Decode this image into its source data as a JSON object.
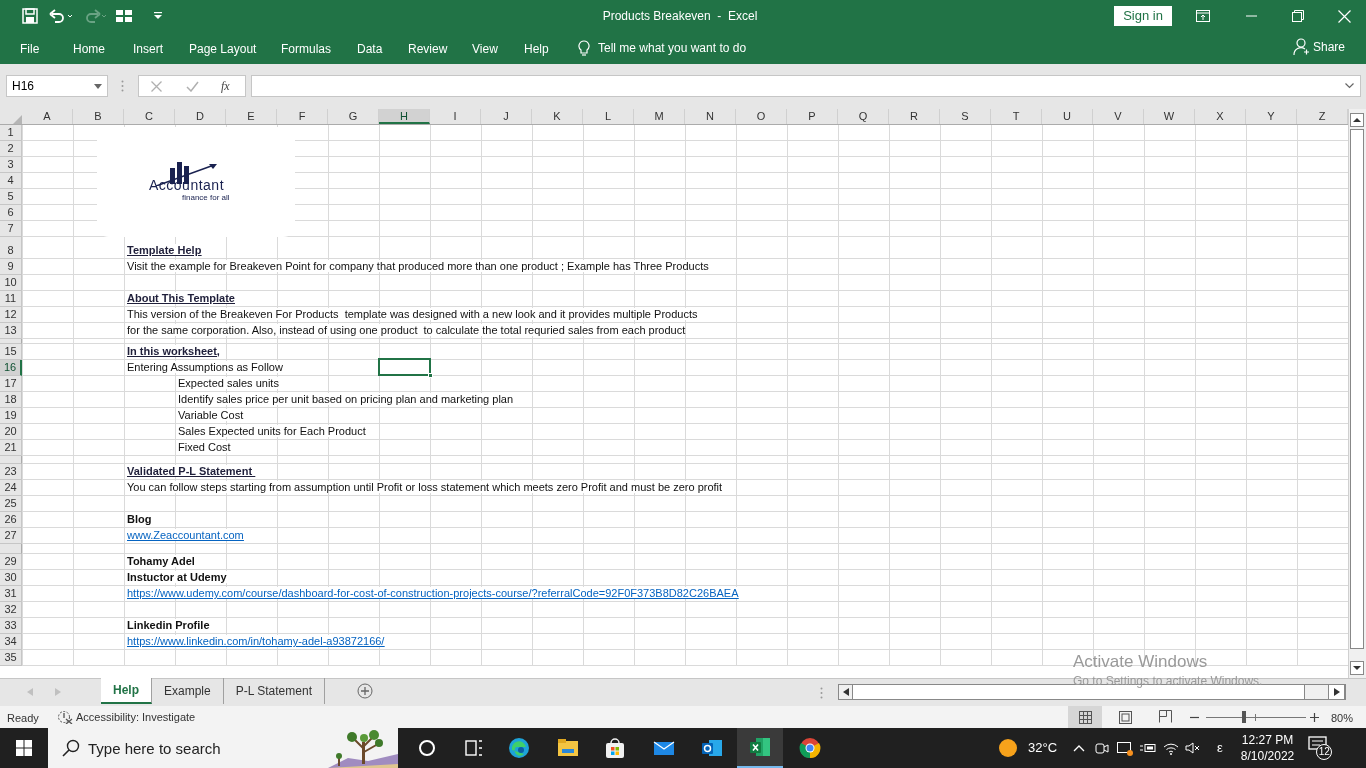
{
  "window": {
    "title": "Products Breakeven  -  Excel",
    "sign_in": "Sign in"
  },
  "ribbon_tabs": [
    {
      "label": "File"
    },
    {
      "label": "Home"
    },
    {
      "label": "Insert"
    },
    {
      "label": "Page Layout"
    },
    {
      "label": "Formulas"
    },
    {
      "label": "Data"
    },
    {
      "label": "Review"
    },
    {
      "label": "View"
    },
    {
      "label": "Help"
    }
  ],
  "tell_me": "Tell me what you want to do",
  "share": "Share",
  "formula_bar": {
    "name_box": "H16",
    "fx": "fx"
  },
  "columns": [
    {
      "label": "A",
      "selected": false
    },
    {
      "label": "B",
      "selected": false
    },
    {
      "label": "C",
      "selected": false
    },
    {
      "label": "D",
      "selected": false
    },
    {
      "label": "E",
      "selected": false
    },
    {
      "label": "F",
      "selected": false
    },
    {
      "label": "G",
      "selected": false
    },
    {
      "label": "H",
      "selected": true
    },
    {
      "label": "I",
      "selected": false
    },
    {
      "label": "J",
      "selected": false
    },
    {
      "label": "K",
      "selected": false
    },
    {
      "label": "L",
      "selected": false
    },
    {
      "label": "M",
      "selected": false
    },
    {
      "label": "N",
      "selected": false
    },
    {
      "label": "O",
      "selected": false
    },
    {
      "label": "P",
      "selected": false
    },
    {
      "label": "Q",
      "selected": false
    },
    {
      "label": "R",
      "selected": false
    },
    {
      "label": "S",
      "selected": false
    },
    {
      "label": "T",
      "selected": false
    },
    {
      "label": "U",
      "selected": false
    },
    {
      "label": "V",
      "selected": false
    },
    {
      "label": "W",
      "selected": false
    },
    {
      "label": "X",
      "selected": false
    },
    {
      "label": "Y",
      "selected": false
    },
    {
      "label": "Z",
      "selected": false
    }
  ],
  "logo": {
    "name": "Accountant",
    "tagline": "finance for all"
  },
  "rows": [
    {
      "number": "1",
      "selected": false
    },
    {
      "number": "2",
      "selected": false
    },
    {
      "number": "3",
      "selected": false
    },
    {
      "number": "4",
      "selected": false
    },
    {
      "number": "5",
      "selected": false
    },
    {
      "number": "6",
      "selected": false
    },
    {
      "number": "7",
      "selected": false
    },
    {
      "number": "8",
      "selected": false,
      "tall": true,
      "cell": {
        "text": "Template Help",
        "kind": "heading"
      }
    },
    {
      "number": "9",
      "selected": false,
      "cell": {
        "text": "Visit the example for Breakeven Point for company that produced more than one product ; Example has Three Products",
        "kind": "text"
      }
    },
    {
      "number": "10",
      "selected": false
    },
    {
      "number": "11",
      "selected": false,
      "cell": {
        "text": "About This Template",
        "kind": "heading"
      }
    },
    {
      "number": "12",
      "selected": false,
      "cell": {
        "text": "This version of the Breakeven For Products  template was designed with a new look and it provides multiple Products",
        "kind": "text"
      }
    },
    {
      "number": "13",
      "selected": false,
      "cell": {
        "text": "for the same corporation. Also, instead of using one product  to calculate the total requried sales from each product",
        "kind": "text"
      }
    },
    {
      "number": "15",
      "selected": false,
      "gap_before": true,
      "cell": {
        "text": "In this worksheet,",
        "kind": "heading"
      }
    },
    {
      "number": "16",
      "selected": true,
      "cell": {
        "text": "Entering Assumptions as Follow",
        "kind": "text"
      }
    },
    {
      "number": "17",
      "selected": false,
      "cell": {
        "text": "Expected sales units",
        "kind": "indent"
      }
    },
    {
      "number": "18",
      "selected": false,
      "cell": {
        "text": "Identify sales price per unit based on pricing plan and marketing plan",
        "kind": "indent"
      }
    },
    {
      "number": "19",
      "selected": false,
      "cell": {
        "text": "Variable Cost",
        "kind": "indent"
      }
    },
    {
      "number": "20",
      "selected": false,
      "cell": {
        "text": "Sales Expected units for Each Product",
        "kind": "indent"
      }
    },
    {
      "number": "21",
      "selected": false,
      "cell": {
        "text": "Fixed Cost",
        "kind": "indent"
      }
    },
    {
      "number": "23",
      "selected": false,
      "gap_before": true,
      "cell": {
        "text": "Validated P-L Statement ",
        "kind": "heading"
      }
    },
    {
      "number": "24",
      "selected": false,
      "cell": {
        "text": "You can follow steps starting from assumption until Profit or loss statement which meets zero Profit and must be zero profit",
        "kind": "text"
      }
    },
    {
      "number": "25",
      "selected": false
    },
    {
      "number": "26",
      "selected": false,
      "cell": {
        "text": "Blog",
        "kind": "bold"
      }
    },
    {
      "number": "27",
      "selected": false,
      "cell": {
        "text": "www.Zeaccountant.com",
        "kind": "link"
      }
    },
    {
      "number": "29",
      "selected": false,
      "gap_before": true,
      "cell": {
        "text": "Tohamy Adel",
        "kind": "bold"
      }
    },
    {
      "number": "30",
      "selected": false,
      "cell": {
        "text": "Instuctor at Udemy",
        "kind": "bold"
      }
    },
    {
      "number": "31",
      "selected": false,
      "cell": {
        "text": "https://www.udemy.com/course/dashboard-for-cost-of-construction-projects-course/?referralCode=92F0F373B8D82C26BAEA",
        "kind": "link"
      }
    },
    {
      "number": "32",
      "selected": false
    },
    {
      "number": "33",
      "selected": false,
      "cell": {
        "text": "Linkedin Profile",
        "kind": "bold"
      }
    },
    {
      "number": "34",
      "selected": false,
      "cell": {
        "text": "https://www.linkedin.com/in/tohamy-adel-a93872166/",
        "kind": "link"
      }
    },
    {
      "number": "35",
      "selected": false
    }
  ],
  "sheet_tabs": [
    {
      "label": "Help",
      "selected": true
    },
    {
      "label": "Example",
      "selected": false
    },
    {
      "label": "P-L Statement",
      "selected": false
    }
  ],
  "status_bar": {
    "mode": "Ready",
    "accessibility": "Accessibility: Investigate",
    "zoom": "80%",
    "zoom_slider": {
      "level": 0.38
    }
  },
  "activation_notice": {
    "title": "Activate Windows",
    "text": "Go to Settings to activate Windows."
  },
  "taskbar": {
    "search_placeholder": "Type here to search",
    "apps": [
      {
        "kind": "cortana",
        "active": false
      },
      {
        "kind": "taskview",
        "active": false
      },
      {
        "kind": "edge",
        "active": false
      },
      {
        "kind": "explorer",
        "active": false
      },
      {
        "kind": "store",
        "active": false
      },
      {
        "kind": "mail",
        "active": false
      },
      {
        "kind": "outlook",
        "active": false
      },
      {
        "kind": "excel",
        "active": true
      },
      {
        "kind": "chrome",
        "active": false
      }
    ],
    "temperature": "32°C",
    "input_indicator": "ε",
    "time": "12:27 PM",
    "date": "8/10/2022",
    "notifications": "12"
  }
}
